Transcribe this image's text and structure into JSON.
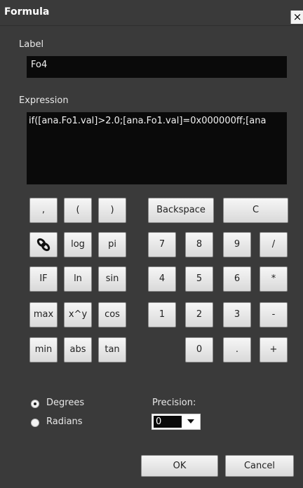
{
  "window": {
    "title": "Formula",
    "close_glyph": "×"
  },
  "label_section": {
    "heading": "Label",
    "value": "Fo4"
  },
  "expression_section": {
    "heading": "Expression",
    "value": "if([ana.Fo1.val]>2.0;[ana.Fo1.val]=0x000000ff;[ana"
  },
  "keypad": {
    "row1": [
      ",",
      "(",
      ")",
      "Backspace",
      "C"
    ],
    "functions": [
      {
        "label": "",
        "icon": "chain-link-icon"
      },
      {
        "label": "log"
      },
      {
        "label": "pi"
      },
      {
        "label": "IF"
      },
      {
        "label": "ln"
      },
      {
        "label": "sin"
      },
      {
        "label": "max"
      },
      {
        "label": "x^y"
      },
      {
        "label": "cos"
      },
      {
        "label": "min"
      },
      {
        "label": "abs"
      },
      {
        "label": "tan"
      }
    ],
    "numbers": [
      "7",
      "8",
      "9",
      "/",
      "4",
      "5",
      "6",
      "*",
      "1",
      "2",
      "3",
      "-",
      "0",
      ".",
      "+"
    ]
  },
  "angle_mode": {
    "degrees_label": "Degrees",
    "radians_label": "Radians",
    "selected": "Degrees"
  },
  "precision": {
    "label": "Precision:",
    "value": "0"
  },
  "footer": {
    "ok_label": "OK",
    "cancel_label": "Cancel"
  }
}
